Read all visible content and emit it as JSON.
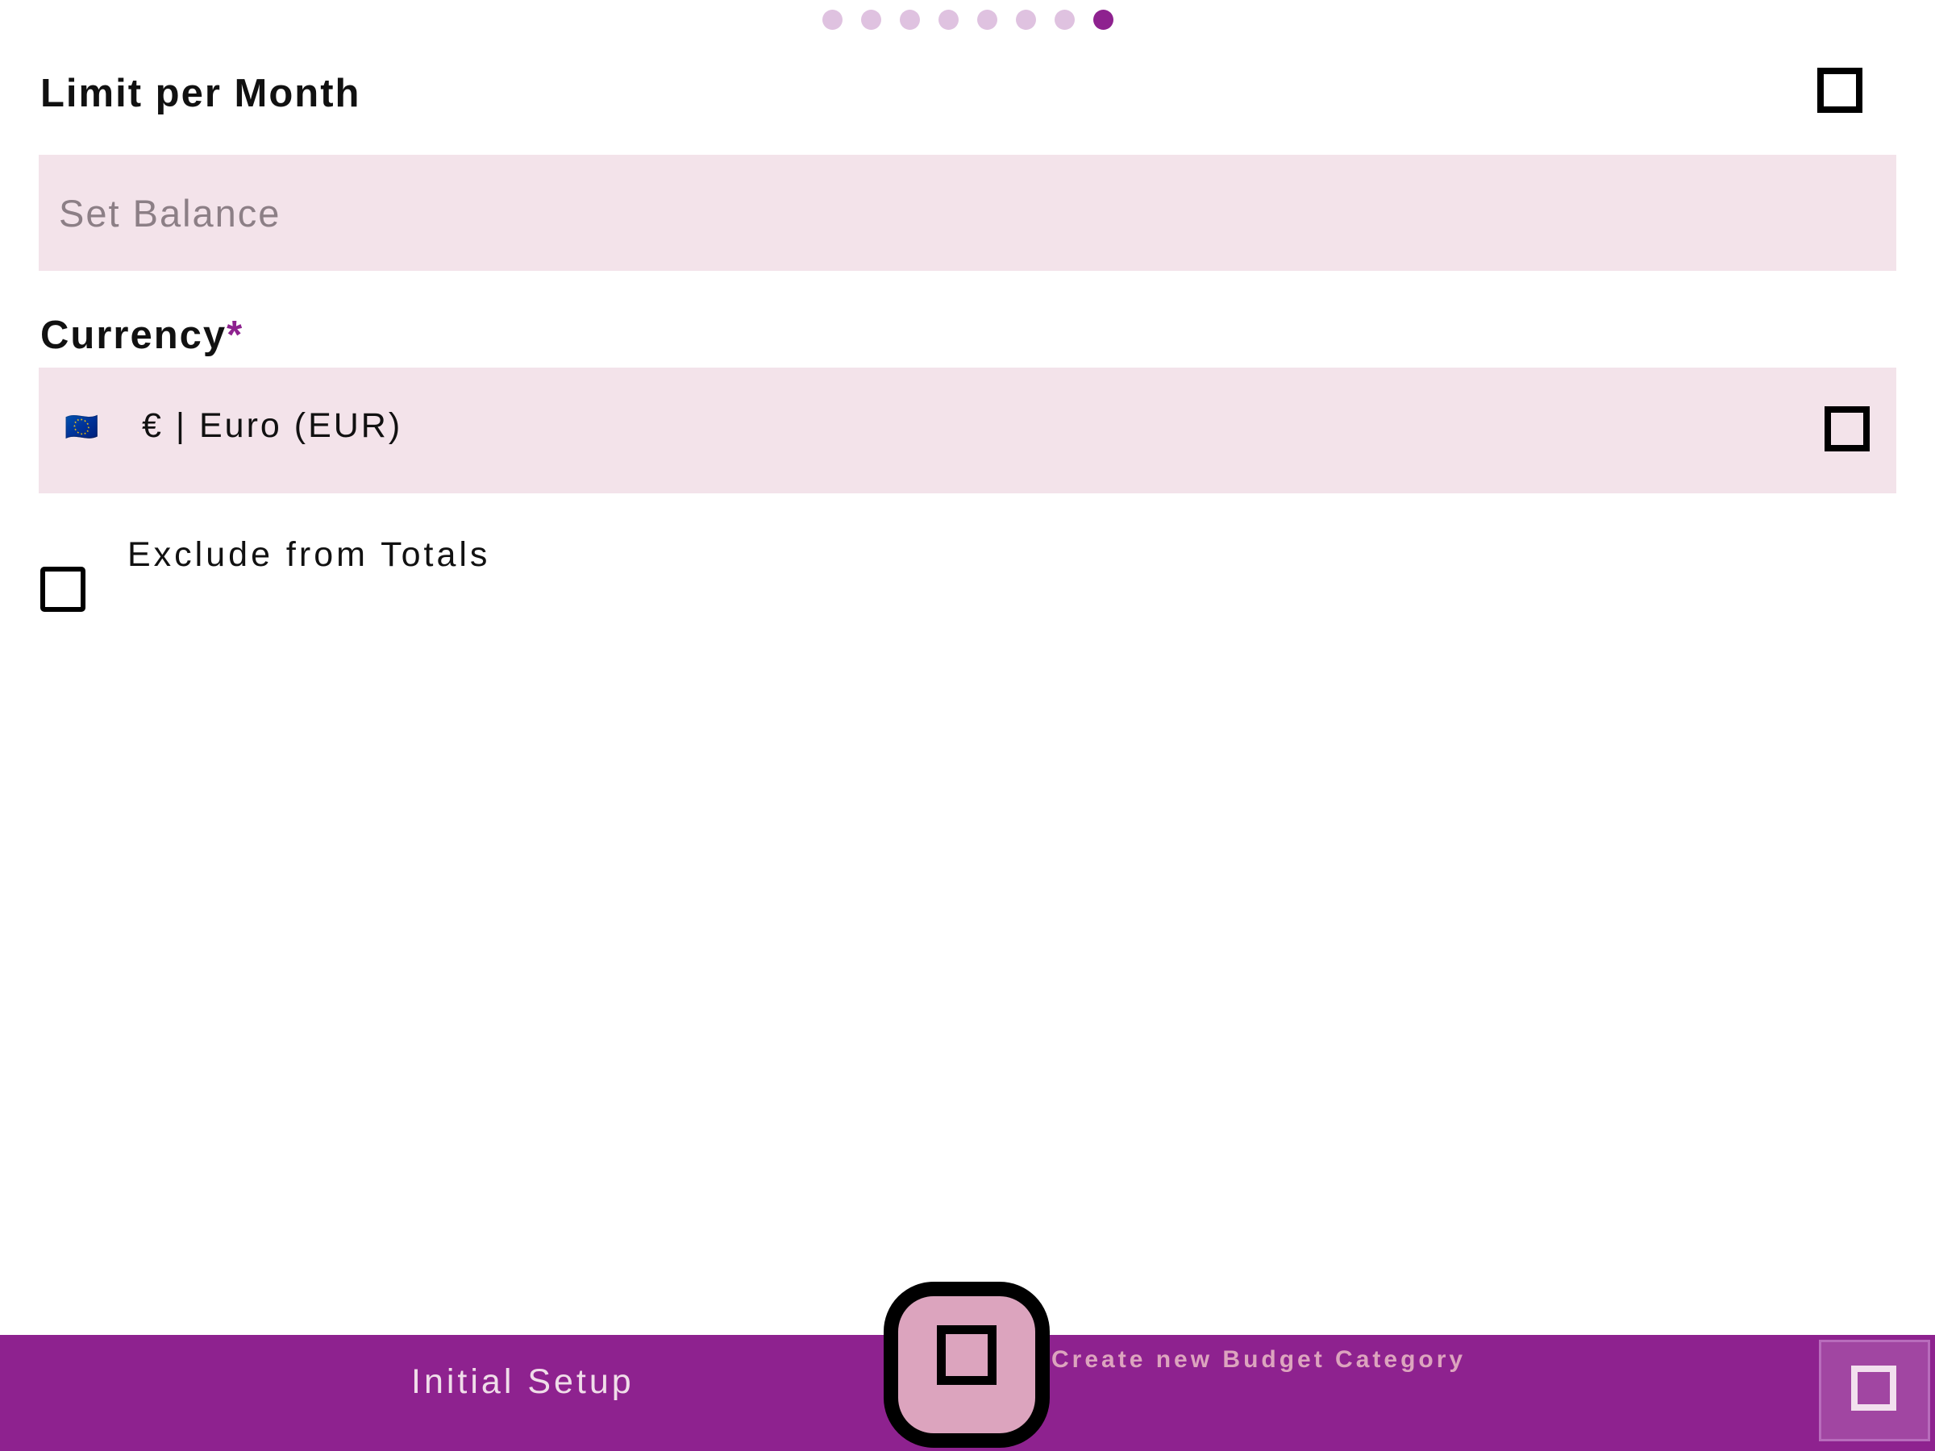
{
  "pagination": {
    "total": 8,
    "active_index": 7
  },
  "limit": {
    "label": "Limit per Month",
    "toggle_icon": "square-icon"
  },
  "balance": {
    "placeholder": "Set Balance",
    "value": ""
  },
  "currency": {
    "label": "Currency",
    "required_mark": "*",
    "flag": "🇪🇺",
    "value": "€ | Euro (EUR)",
    "dropdown_icon": "square-icon"
  },
  "exclude": {
    "label": "Exclude from Totals",
    "checked": false
  },
  "bottom_bar": {
    "title": "Initial Setup",
    "fab_caption": "Create new Budget Category",
    "fab_icon": "square-icon",
    "corner_icon": "square-icon"
  },
  "colors": {
    "accent": "#8e228f",
    "dot_inactive": "#dfc2e0",
    "field_bg": "#f3e3ea",
    "fab_bg": "#dca4be"
  }
}
